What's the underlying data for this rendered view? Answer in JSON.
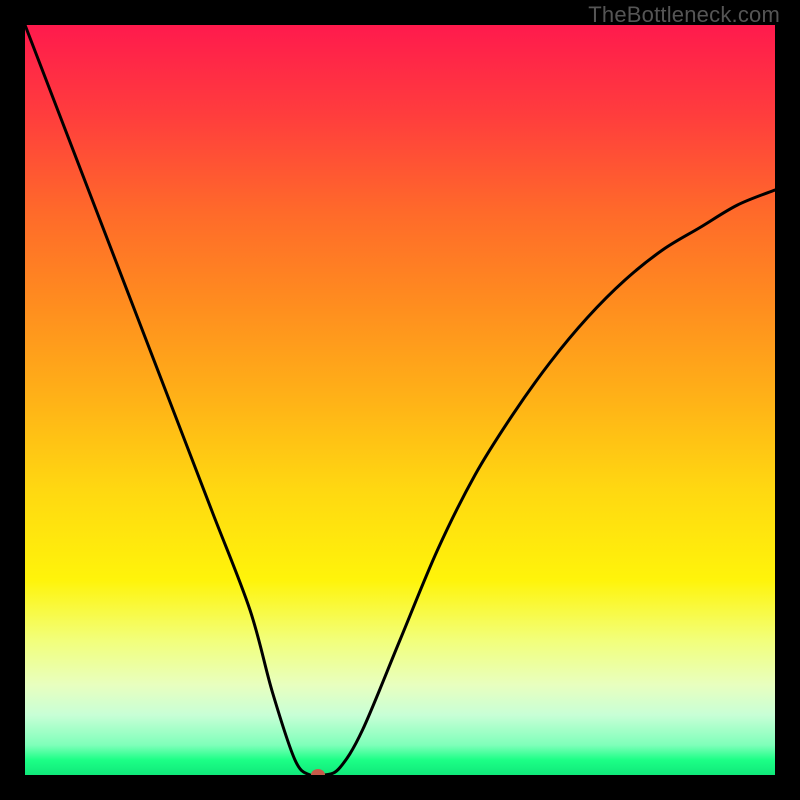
{
  "watermark": "TheBottleneck.com",
  "colors": {
    "frame_bg": "#000000",
    "gradient_top": "#ff1a4d",
    "gradient_bottom": "#10e87a",
    "curve": "#000000",
    "dot": "#c75a4a"
  },
  "chart_data": {
    "type": "line",
    "title": "",
    "xlabel": "",
    "ylabel": "",
    "xlim": [
      0,
      100
    ],
    "ylim": [
      0,
      100
    ],
    "grid": false,
    "legend": false,
    "series": [
      {
        "name": "bottleneck-curve",
        "x": [
          0,
          5,
          10,
          15,
          20,
          25,
          30,
          33,
          36,
          38,
          40,
          42,
          45,
          50,
          55,
          60,
          65,
          70,
          75,
          80,
          85,
          90,
          95,
          100
        ],
        "y": [
          100,
          87,
          74,
          61,
          48,
          35,
          22,
          11,
          2,
          0,
          0,
          1,
          6,
          18,
          30,
          40,
          48,
          55,
          61,
          66,
          70,
          73,
          76,
          78
        ]
      }
    ],
    "annotations": [
      {
        "name": "minimum-dot",
        "x": 39,
        "y": 0
      }
    ]
  }
}
